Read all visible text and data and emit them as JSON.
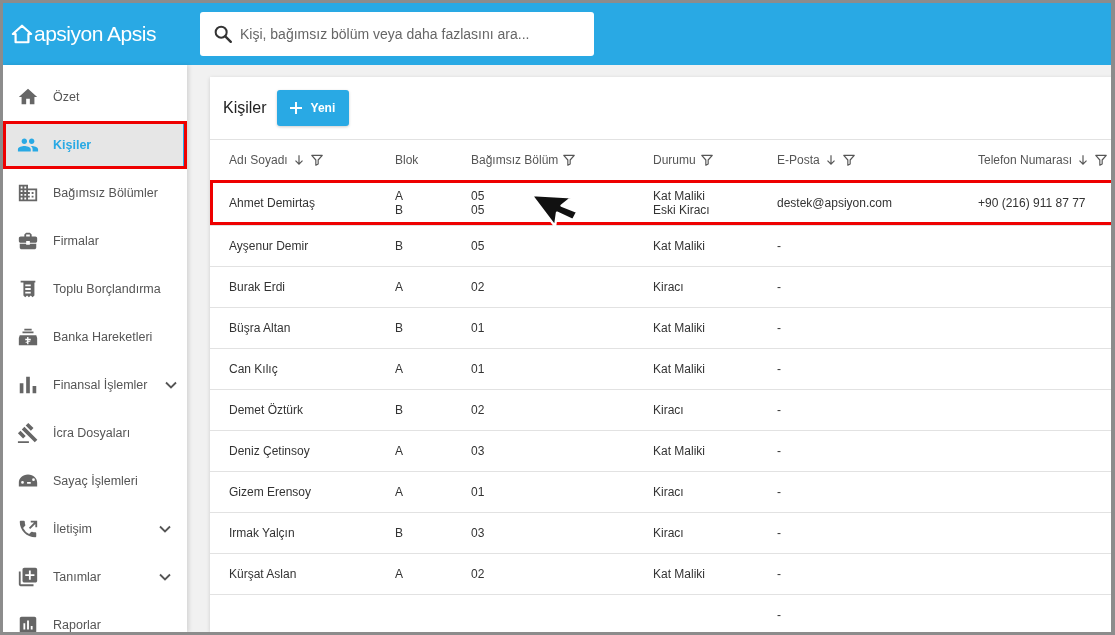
{
  "header": {
    "logo": "apsiyon Apsis",
    "search": {
      "placeholder": "Kişi, bağımsız bölüm veya daha fazlasını ara..."
    }
  },
  "sidebar": {
    "items": [
      {
        "kind": "home",
        "label": "Özet",
        "selected": false,
        "highlighted": false,
        "expandable": false
      },
      {
        "kind": "people",
        "label": "Kişiler",
        "selected": true,
        "highlighted": true,
        "expandable": false
      },
      {
        "kind": "building",
        "label": "Bağımsız Bölümler",
        "selected": false,
        "highlighted": false,
        "expandable": false
      },
      {
        "kind": "briefcase",
        "label": "Firmalar",
        "selected": false,
        "highlighted": false,
        "expandable": false
      },
      {
        "kind": "receipt",
        "label": "Toplu Borçlandırma",
        "selected": false,
        "highlighted": false,
        "expandable": false
      },
      {
        "kind": "bank",
        "label": "Banka Hareketleri",
        "selected": false,
        "highlighted": false,
        "expandable": false
      },
      {
        "kind": "chart",
        "label": "Finansal İşlemler",
        "selected": false,
        "highlighted": false,
        "expandable": true
      },
      {
        "kind": "gavel",
        "label": "İcra Dosyaları",
        "selected": false,
        "highlighted": false,
        "expandable": false
      },
      {
        "kind": "meter",
        "label": "Sayaç İşlemleri",
        "selected": false,
        "highlighted": false,
        "expandable": false
      },
      {
        "kind": "phone",
        "label": "İletişim",
        "selected": false,
        "highlighted": false,
        "expandable": true
      },
      {
        "kind": "addbox",
        "label": "Tanımlar",
        "selected": false,
        "highlighted": false,
        "expandable": true
      },
      {
        "kind": "report",
        "label": "Raporlar",
        "selected": false,
        "highlighted": false,
        "expandable": false
      }
    ]
  },
  "content": {
    "title": "Kişiler",
    "new_button": "Yeni",
    "table": {
      "columns": [
        {
          "label": "Adı Soyadı",
          "sortable": true,
          "filter": true
        },
        {
          "label": "Blok",
          "sortable": false,
          "filter": false
        },
        {
          "label": "Bağımsız Bölüm",
          "sortable": false,
          "filter": true
        },
        {
          "label": "Durumu",
          "sortable": false,
          "filter": true
        },
        {
          "label": "E-Posta",
          "sortable": true,
          "filter": true
        },
        {
          "label": "Telefon Numarası",
          "sortable": true,
          "filter": true
        }
      ],
      "rows": [
        {
          "name": "Ahmet Demirtaş",
          "blok": [
            "A",
            "B"
          ],
          "bolum": [
            "05",
            "05"
          ],
          "durum": [
            "Kat Maliki",
            "Eski Kiracı"
          ],
          "email": "destek@apsiyon.com",
          "phone": "+90 (216) 911 87 77",
          "highlighted": true
        },
        {
          "name": "Ayşenur Demir",
          "blok": [
            "B"
          ],
          "bolum": [
            "05"
          ],
          "durum": [
            "Kat Maliki"
          ],
          "email": "-",
          "highlighted": false
        },
        {
          "name": "Burak Erdi",
          "blok": [
            "A"
          ],
          "bolum": [
            "02"
          ],
          "durum": [
            "Kiracı"
          ],
          "email": "-",
          "highlighted": false
        },
        {
          "name": "Büşra Altan",
          "blok": [
            "B"
          ],
          "bolum": [
            "01"
          ],
          "durum": [
            "Kat Maliki"
          ],
          "email": "-",
          "highlighted": false
        },
        {
          "name": "Can Kılıç",
          "blok": [
            "A"
          ],
          "bolum": [
            "01"
          ],
          "durum": [
            "Kat Maliki"
          ],
          "email": "-",
          "highlighted": false
        },
        {
          "name": "Demet Öztürk",
          "blok": [
            "B"
          ],
          "bolum": [
            "02"
          ],
          "durum": [
            "Kiracı"
          ],
          "email": "-",
          "highlighted": false
        },
        {
          "name": "Deniz Çetinsoy",
          "blok": [
            "A"
          ],
          "bolum": [
            "03"
          ],
          "durum": [
            "Kat Maliki"
          ],
          "email": "-",
          "highlighted": false
        },
        {
          "name": "Gizem Erensoy",
          "blok": [
            "A"
          ],
          "bolum": [
            "01"
          ],
          "durum": [
            "Kiracı"
          ],
          "email": "-",
          "highlighted": false
        },
        {
          "name": "Irmak Yalçın",
          "blok": [
            "B"
          ],
          "bolum": [
            "03"
          ],
          "durum": [
            "Kiracı"
          ],
          "email": "-",
          "highlighted": false
        },
        {
          "name": "Kürşat Aslan",
          "blok": [
            "A"
          ],
          "bolum": [
            "02"
          ],
          "durum": [
            "Kat Maliki"
          ],
          "email": "-",
          "highlighted": false
        },
        {
          "email": "-",
          "highlighted": false
        }
      ]
    }
  }
}
